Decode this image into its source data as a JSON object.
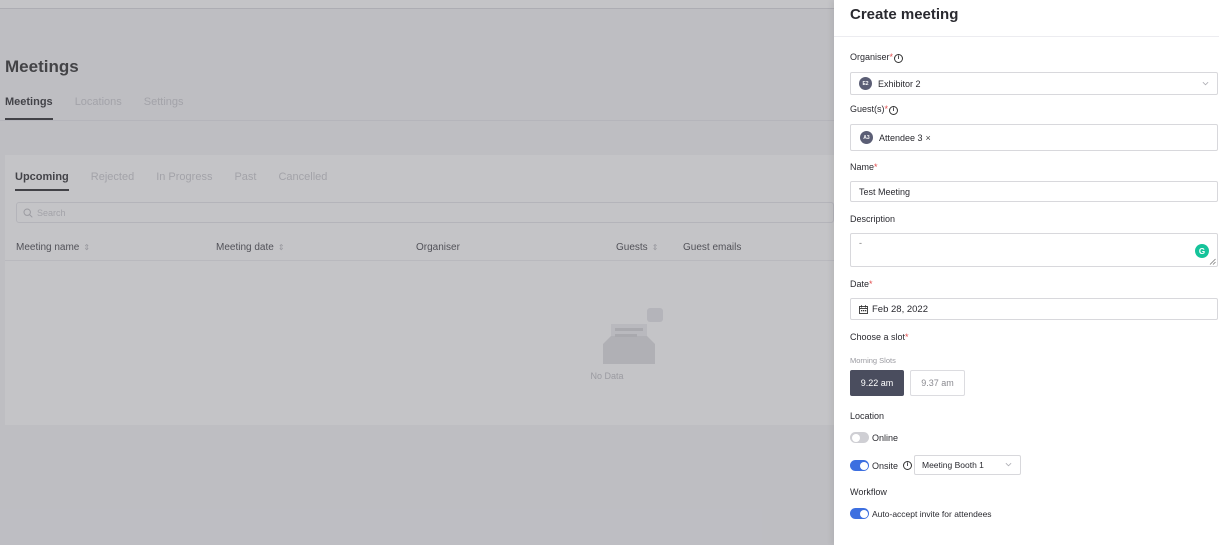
{
  "background": {
    "page_title": "Meetings",
    "tabs": [
      {
        "label": "Meetings",
        "active": true
      },
      {
        "label": "Locations",
        "active": false
      },
      {
        "label": "Settings",
        "active": false
      }
    ],
    "subtabs": [
      {
        "label": "Upcoming",
        "active": true
      },
      {
        "label": "Rejected",
        "active": false
      },
      {
        "label": "In Progress",
        "active": false
      },
      {
        "label": "Past",
        "active": false
      },
      {
        "label": "Cancelled",
        "active": false
      }
    ],
    "search_placeholder": "Search",
    "columns": [
      "Meeting name",
      "Meeting date",
      "Organiser",
      "Guests",
      "Guest emails"
    ],
    "empty_text": "No Data"
  },
  "drawer": {
    "title": "Create meeting",
    "organiser": {
      "label": "Organiser",
      "required_mark": "*",
      "avatar": "E2",
      "value": "Exhibitor 2"
    },
    "guests": {
      "label": "Guest(s)",
      "required_mark": "*",
      "tags": [
        {
          "avatar": "A3",
          "value": "Attendee 3",
          "remove": "×"
        }
      ]
    },
    "name": {
      "label": "Name",
      "required_mark": "*",
      "value": "Test Meeting"
    },
    "description": {
      "label": "Description",
      "value": "-"
    },
    "date": {
      "label": "Date",
      "required_mark": "*",
      "value": "Feb 28, 2022"
    },
    "slot": {
      "label": "Choose a slot",
      "required_mark": "*",
      "group_label": "Morning Slots",
      "options": [
        {
          "label": "9.22 am",
          "selected": true
        },
        {
          "label": "9.37 am",
          "selected": false
        }
      ]
    },
    "location": {
      "label": "Location",
      "online": {
        "label": "Online",
        "enabled": false
      },
      "onsite": {
        "label": "Onsite",
        "enabled": true,
        "booth": "Meeting Booth 1"
      }
    },
    "workflow": {
      "label": "Workflow",
      "auto_accept": {
        "label": "Auto-accept invite for attendees",
        "enabled": true
      }
    }
  },
  "colors": {
    "primary_toggle": "#3d6fe0",
    "selected_slot": "#4a4d5e",
    "required": "#e24c4c",
    "grammarly": "#15c39a"
  }
}
